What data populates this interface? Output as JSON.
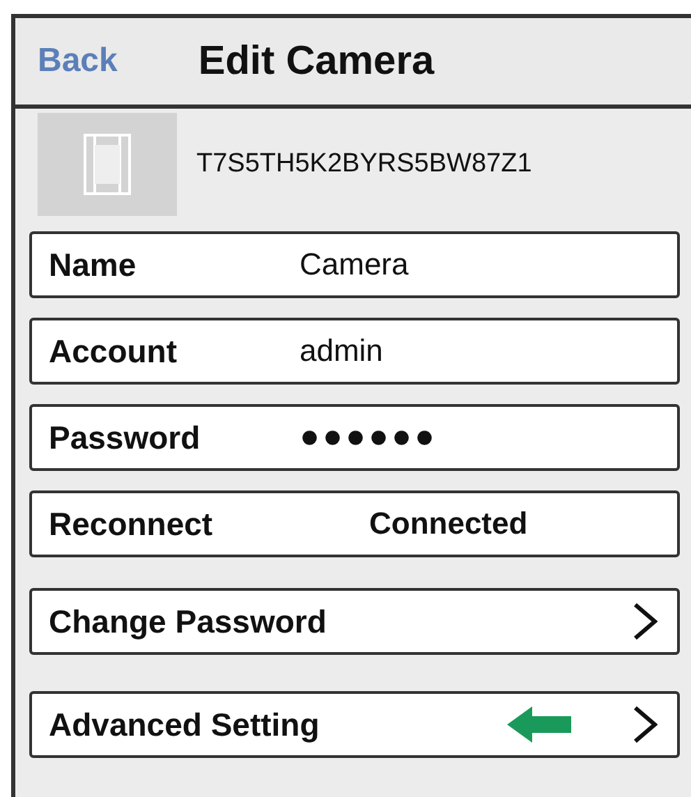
{
  "header": {
    "back": "Back",
    "title": "Edit Camera"
  },
  "camera": {
    "id": "T7S5TH5K2BYRS5BW87Z1"
  },
  "fields": [
    {
      "kind": "text",
      "label": "Name",
      "value": "Camera"
    },
    {
      "kind": "text",
      "label": "Account",
      "value": "admin"
    },
    {
      "kind": "password",
      "label": "Password",
      "value": "●●●●●●"
    },
    {
      "kind": "status",
      "label": "Reconnect",
      "value": "Connected"
    }
  ],
  "links": [
    {
      "label": "Change Password",
      "highlighted": false
    },
    {
      "label": "Advanced Setting",
      "highlighted": true
    }
  ]
}
